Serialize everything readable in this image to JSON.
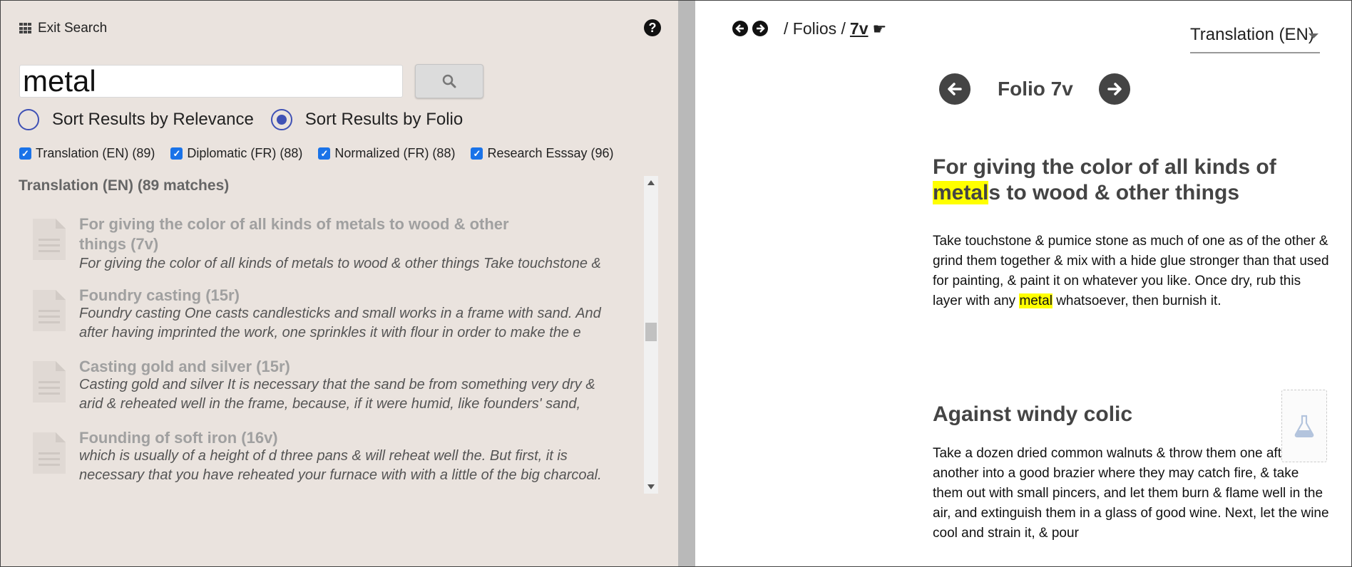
{
  "left": {
    "exit_label": "Exit Search",
    "help_icon": "question-circle-icon",
    "search": {
      "value": "metal",
      "button_icon": "search-icon"
    },
    "sort": {
      "relevance_label": "Sort Results by Relevance",
      "folio_label": "Sort Results by Folio",
      "selected": "folio"
    },
    "filters": [
      {
        "label": "Translation (EN) (89)",
        "checked": true
      },
      {
        "label": "Diplomatic (FR) (88)",
        "checked": true
      },
      {
        "label": "Normalized (FR) (88)",
        "checked": true
      },
      {
        "label": "Research Esssay (96)",
        "checked": true
      }
    ],
    "results_heading": "Translation (EN) (89 matches)",
    "results": [
      {
        "title_line1": "For giving the color of all kinds of metals to wood & other",
        "title_line2": "things  (7v)",
        "snippet1": "For giving the color of all kinds of metals to wood & other things Take touchstone &",
        "snippet2": ""
      },
      {
        "title_line1": "Foundry casting  (15r)",
        "title_line2": "",
        "snippet1": "Foundry casting One casts candlesticks and small works in a frame with sand. And",
        "snippet2": "after having imprinted the work, one sprinkles it with flour in order to make the e"
      },
      {
        "title_line1": "Casting gold and silver  (15r)",
        "title_line2": "",
        "snippet1": "Casting gold and silver It is necessary that the sand be from something very dry &",
        "snippet2": "arid & reheated well in the frame, because, if it were humid, like founders' sand,"
      },
      {
        "title_line1": "Founding of soft iron  (16v)",
        "title_line2": "",
        "snippet1": "which is usually of a height of d three pans & will reheat well the. But first, it is",
        "snippet2": "necessary that you have reheated your furnace with with a little of the big charcoal."
      }
    ]
  },
  "right": {
    "breadcrumb": {
      "root": "/ Folios /",
      "current": "7v"
    },
    "language": "Translation (EN)",
    "folio_title": "Folio 7v",
    "section1": {
      "heading_pre": "For giving the color of all kinds of",
      "heading_hl": "metal",
      "heading_post": "s to wood & other things",
      "para_pre": "Take touchstone & pumice stone as much of one as of the other & grind them together & mix with a hide glue stronger than that used for painting, & paint it on whatever you like. Once dry, rub this layer with any",
      "para_hl": "metal",
      "para_post": "whatsoever, then burnish it."
    },
    "section2": {
      "heading": "Against windy colic",
      "para": "Take a dozen dried common walnuts & throw them one after another into a good brazier where they may catch fire, & take them out with small pincers, and let them burn & flame well in the air, and extinguish them in a glass of good wine. Next, let the wine cool and strain it, & pour"
    },
    "flask_icon": "flask-icon"
  },
  "colors": {
    "left_bg": "#eae3de",
    "splitter": "#b9b9b9",
    "radio_accent": "#3f51b5",
    "highlight": "#ffff00"
  }
}
